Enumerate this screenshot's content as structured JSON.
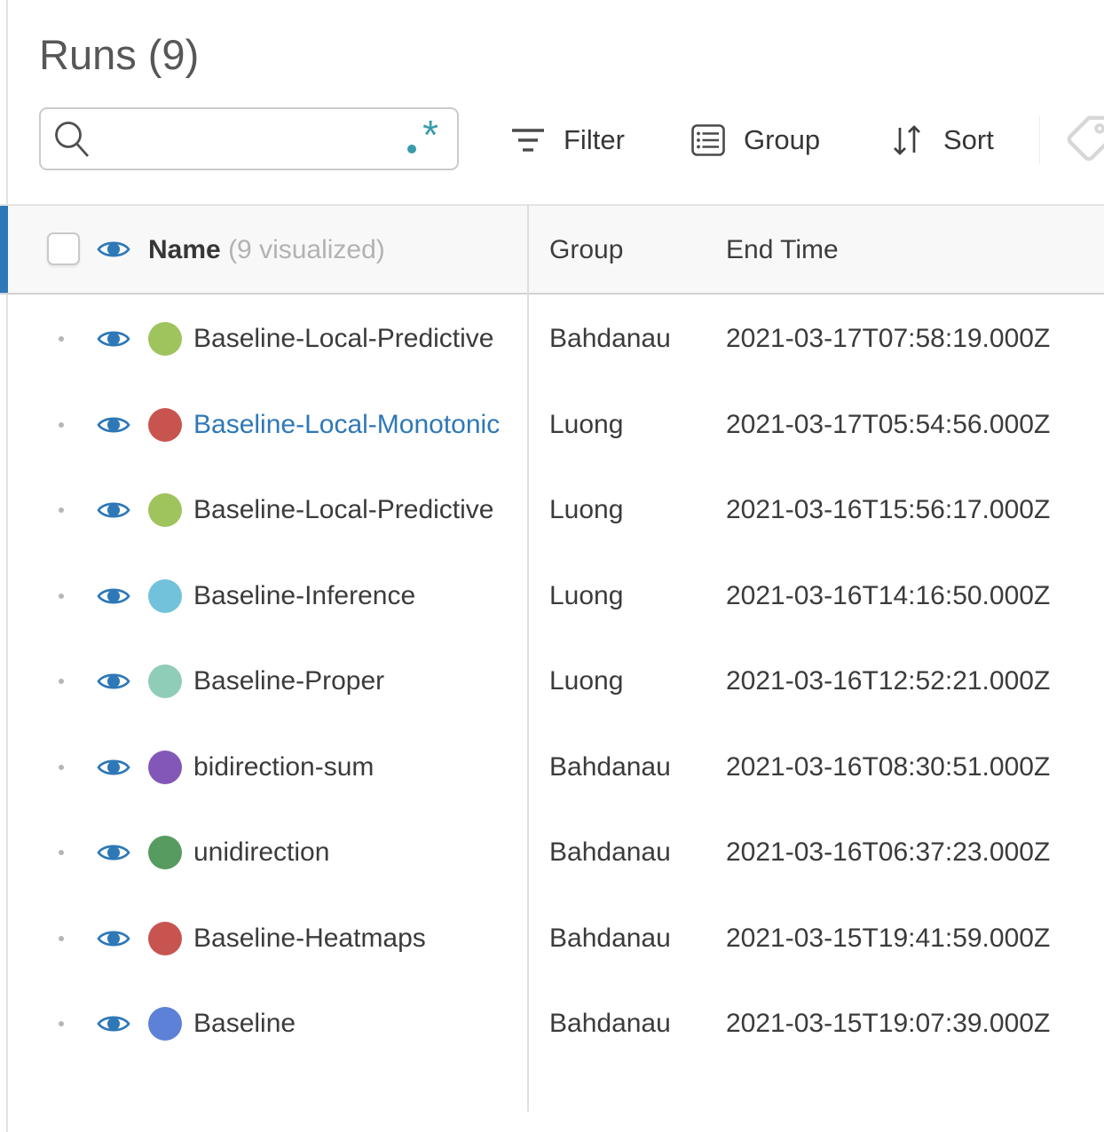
{
  "header": {
    "title": "Runs (9)"
  },
  "search": {
    "value": "",
    "placeholder": ""
  },
  "toolbar": {
    "filter_label": "Filter",
    "group_label": "Group",
    "sort_label": "Sort"
  },
  "table": {
    "columns": {
      "name_label": "Name",
      "name_annotation": "(9 visualized)",
      "group_label": "Group",
      "end_time_label": "End Time"
    },
    "rows": [
      {
        "name": "Baseline-Local-Predictive",
        "color": "#9fc45e",
        "name_color": "#3b3b3b",
        "group": "Bahdanau",
        "end_time": "2021-03-17T07:58:19.000Z"
      },
      {
        "name": "Baseline-Local-Monotonic",
        "color": "#c85450",
        "name_color": "#2e78b7",
        "group": "Luong",
        "end_time": "2021-03-17T05:54:56.000Z"
      },
      {
        "name": "Baseline-Local-Predictive",
        "color": "#9fc45e",
        "name_color": "#3b3b3b",
        "group": "Luong",
        "end_time": "2021-03-16T15:56:17.000Z"
      },
      {
        "name": "Baseline-Inference",
        "color": "#72c2dc",
        "name_color": "#3b3b3b",
        "group": "Luong",
        "end_time": "2021-03-16T14:16:50.000Z"
      },
      {
        "name": "Baseline-Proper",
        "color": "#90cdb8",
        "name_color": "#3b3b3b",
        "group": "Luong",
        "end_time": "2021-03-16T12:52:21.000Z"
      },
      {
        "name": "bidirection-sum",
        "color": "#8357b8",
        "name_color": "#3b3b3b",
        "group": "Bahdanau",
        "end_time": "2021-03-16T08:30:51.000Z"
      },
      {
        "name": "unidirection",
        "color": "#579b61",
        "name_color": "#3b3b3b",
        "group": "Bahdanau",
        "end_time": "2021-03-16T06:37:23.000Z"
      },
      {
        "name": "Baseline-Heatmaps",
        "color": "#c85450",
        "name_color": "#3b3b3b",
        "group": "Bahdanau",
        "end_time": "2021-03-15T19:41:59.000Z"
      },
      {
        "name": "Baseline",
        "color": "#5d81d6",
        "name_color": "#3b3b3b",
        "group": "Bahdanau",
        "end_time": "2021-03-15T19:07:39.000Z"
      }
    ]
  },
  "colors": {
    "accent_blue": "#2e78b7",
    "link_blue": "#2e78b7",
    "regex_teal": "#3a9cab",
    "header_bg": "#f8f8f8"
  }
}
